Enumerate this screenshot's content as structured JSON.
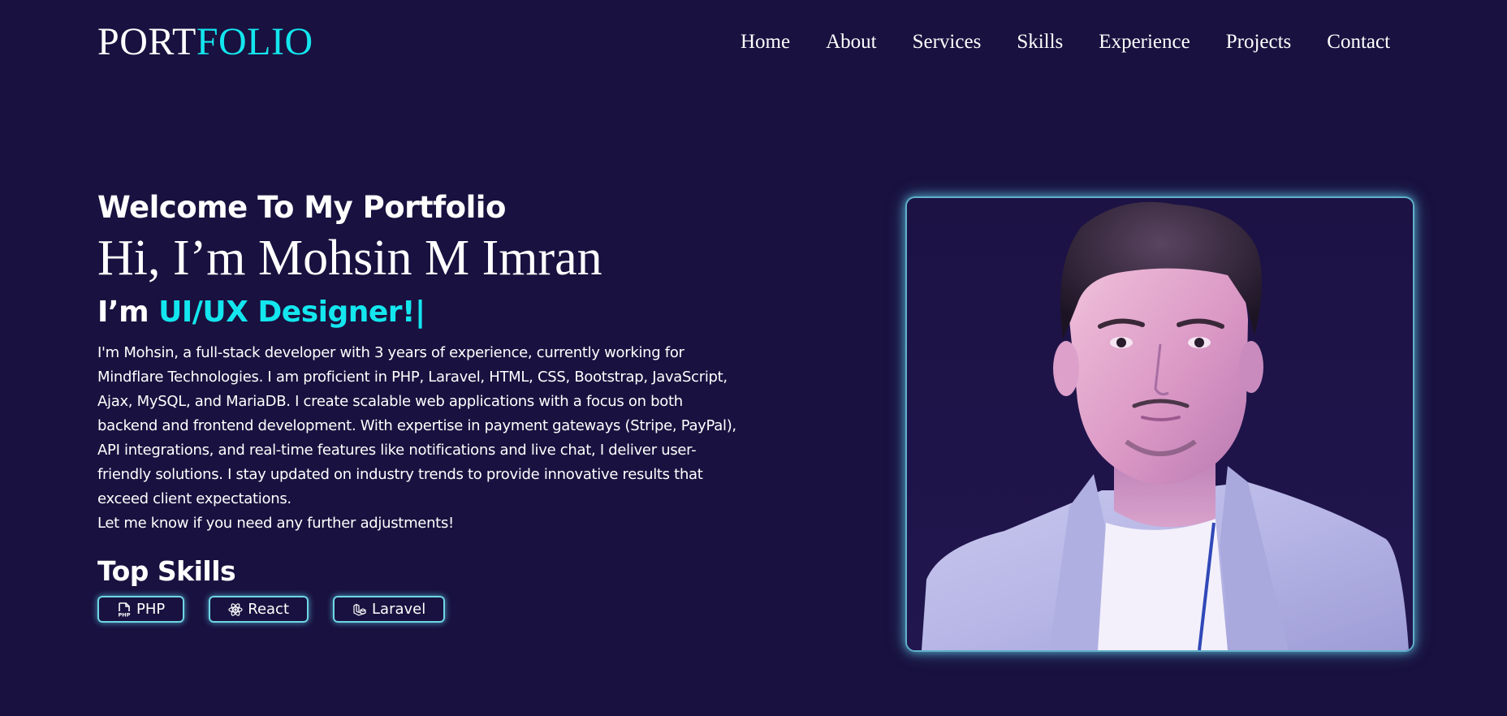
{
  "header": {
    "logo_main": "PORT",
    "logo_accent": "FOLIO",
    "nav": [
      "Home",
      "About",
      "Services",
      "Skills",
      "Experience",
      "Projects",
      "Contact"
    ]
  },
  "hero": {
    "welcome": "Welcome To My Portfolio",
    "name": "Hi, I’m Mohsin M Imran",
    "role_prefix": "I’m ",
    "role_accent": "UI/UX Designer!|",
    "bio": "I'm Mohsin, a full-stack developer with 3 years of experience, currently working for Mindflare Technologies. I am proficient in PHP, Laravel, HTML, CSS, Bootstrap, JavaScript, Ajax, MySQL, and MariaDB. I create scalable web applications with a focus on both backend and frontend development. With expertise in payment gateways (Stripe, PayPal), API integrations, and real-time features like notifications and live chat, I deliver user-friendly solutions. I stay updated on industry trends to provide innovative results that exceed client expectations.",
    "bio_note": "Let me know if you need any further adjustments!",
    "skills_title": "Top Skills",
    "skills": [
      {
        "label": "PHP",
        "icon": "php-file-icon"
      },
      {
        "label": "React",
        "icon": "react-atom-icon"
      },
      {
        "label": "Laravel",
        "icon": "laravel-icon"
      }
    ]
  },
  "colors": {
    "background": "#19113f",
    "accent": "#13e6ee",
    "text": "#ffffff",
    "border_glow": "#6fd6e6"
  }
}
